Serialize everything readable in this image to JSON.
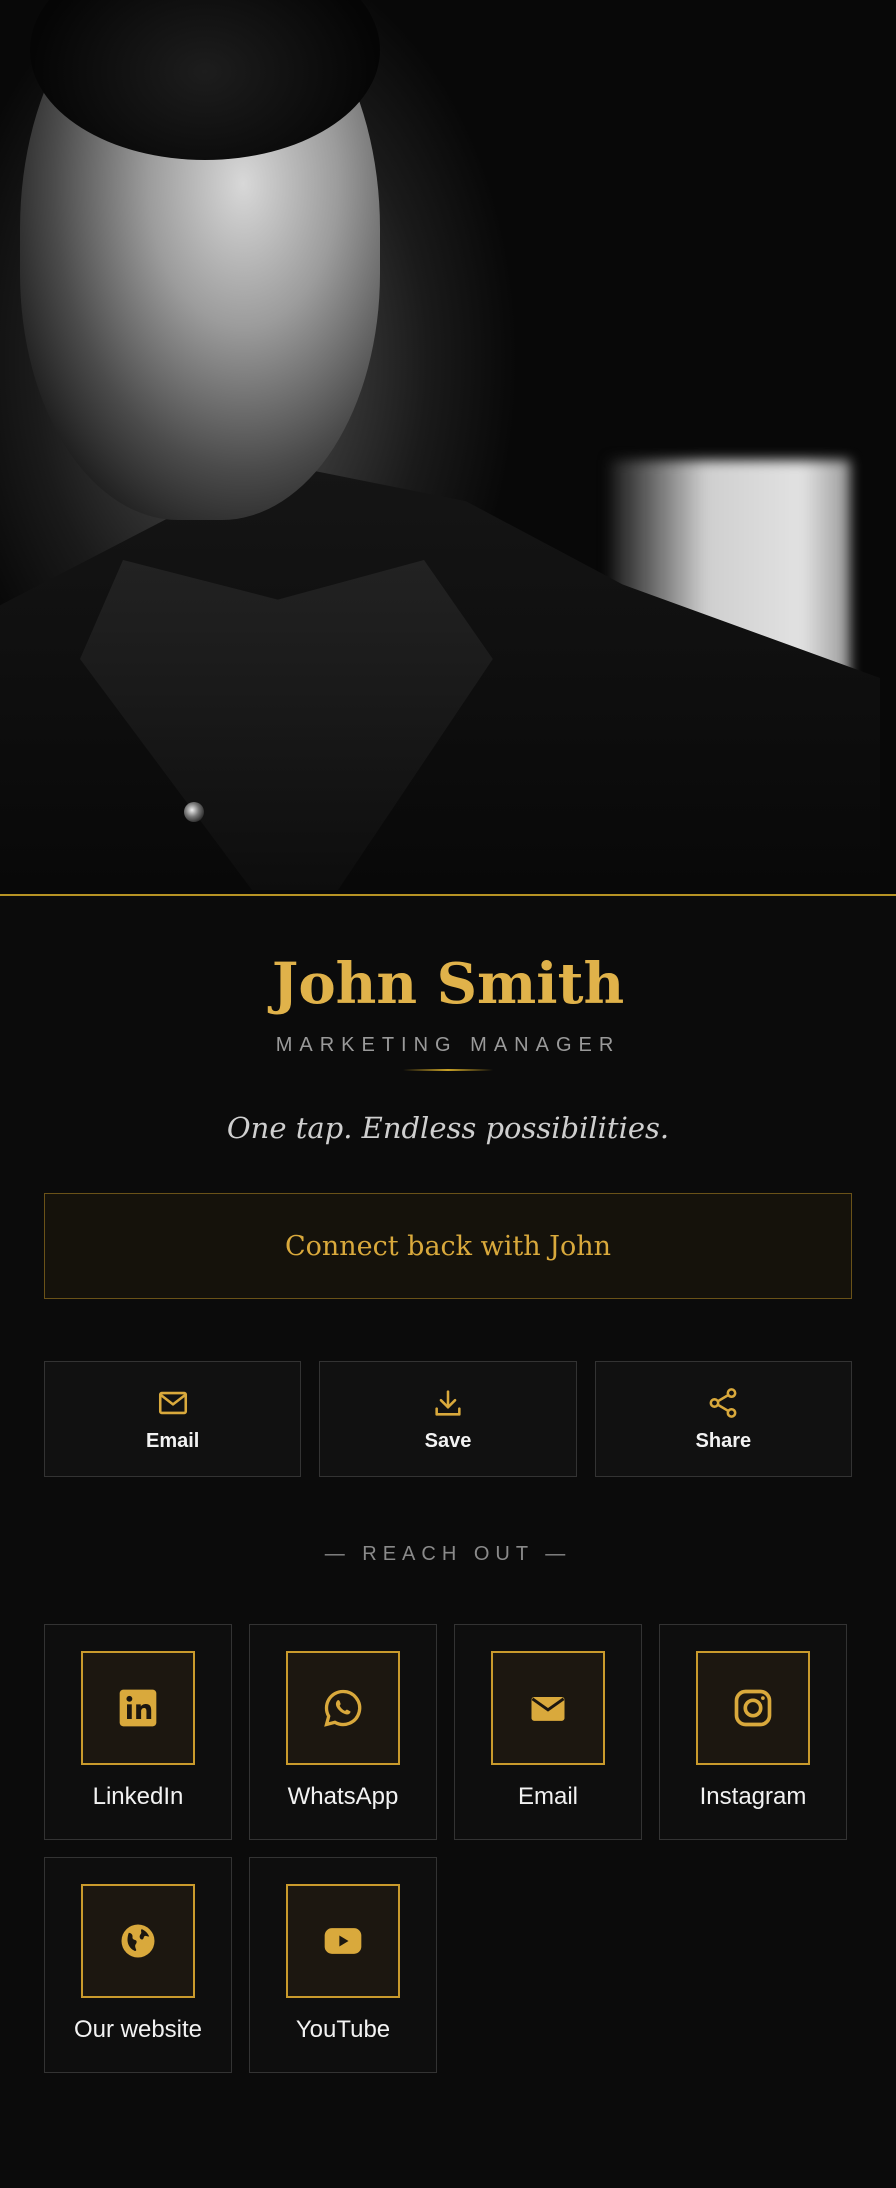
{
  "profile": {
    "name": "John Smith",
    "title": "MARKETING MANAGER",
    "tagline": "One tap. Endless possibilities."
  },
  "connect": {
    "label": "Connect back with John"
  },
  "actions": [
    {
      "label": "Email",
      "icon": "mail-outline-icon"
    },
    {
      "label": "Save",
      "icon": "download-icon"
    },
    {
      "label": "Share",
      "icon": "share-icon"
    }
  ],
  "reach_out": {
    "heading": "— REACH OUT —"
  },
  "links": [
    {
      "label": "LinkedIn",
      "icon": "linkedin-icon"
    },
    {
      "label": "WhatsApp",
      "icon": "whatsapp-icon"
    },
    {
      "label": "Email",
      "icon": "mail-icon"
    },
    {
      "label": "Instagram",
      "icon": "instagram-icon"
    },
    {
      "label": "Our website",
      "icon": "globe-icon"
    },
    {
      "label": "YouTube",
      "icon": "youtube-icon"
    }
  ],
  "colors": {
    "accent": "#c99a2c",
    "background": "#0b0b0b"
  }
}
